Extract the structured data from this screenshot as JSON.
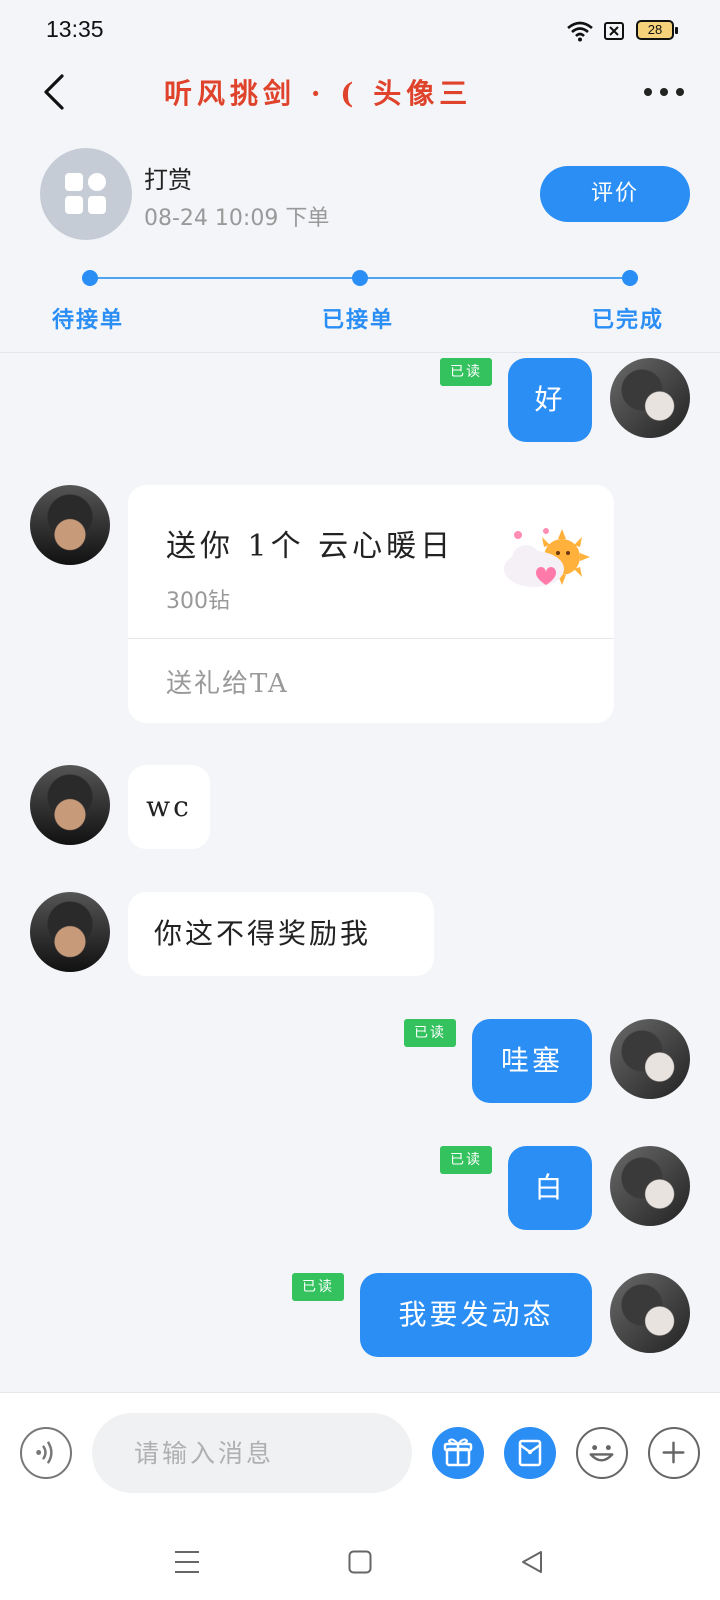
{
  "status_bar": {
    "time": "13:35",
    "battery": "28"
  },
  "header": {
    "title": "听风挑剑 · ( 头像三"
  },
  "order": {
    "name": "打赏",
    "time": "08-24 10:09 下单",
    "rate_button": "评价",
    "steps": [
      "待接单",
      "已接单",
      "已完成"
    ]
  },
  "messages": {
    "m1": {
      "text": "好",
      "read": "已读"
    },
    "gift": {
      "title": "送你 1个 云心暖日",
      "price": "300钻",
      "action": "送礼给TA"
    },
    "m3": {
      "text": "wc"
    },
    "m4": {
      "text": "你这不得奖励我"
    },
    "m5": {
      "text": "哇塞",
      "read": "已读"
    },
    "m6": {
      "text": "白",
      "read": "已读"
    },
    "m7": {
      "text": "我要发动态",
      "read": "已读"
    }
  },
  "input": {
    "placeholder": "请输入消息"
  },
  "colors": {
    "accent": "#2a8ef5",
    "title": "#e0432b",
    "read_badge": "#33c25e"
  }
}
